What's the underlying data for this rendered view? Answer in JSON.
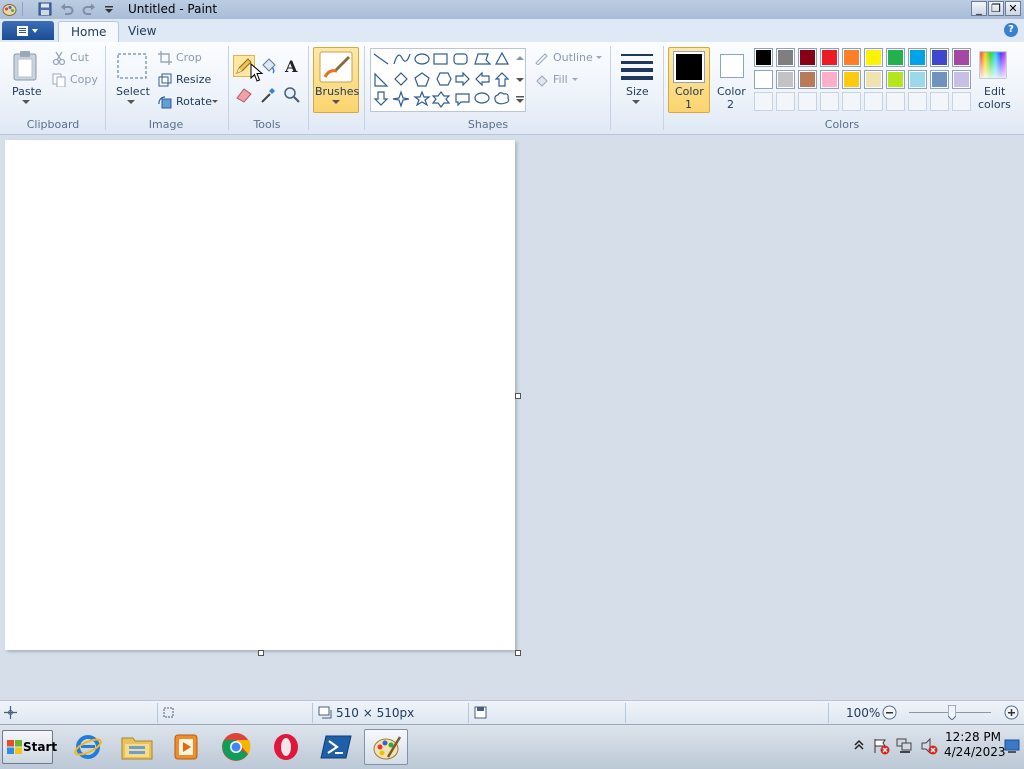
{
  "window": {
    "title": "Untitled - Paint",
    "controls": {
      "minimize": "_",
      "restore": "❐",
      "close": "✕"
    }
  },
  "tabs": [
    {
      "label": "Home",
      "active": true
    },
    {
      "label": "View",
      "active": false
    }
  ],
  "help": "?",
  "ribbon": {
    "clipboard": {
      "paste": "Paste",
      "cut": "Cut",
      "copy": "Copy",
      "group": "Clipboard"
    },
    "image": {
      "select": "Select",
      "crop": "Crop",
      "resize": "Resize",
      "rotate": "Rotate",
      "group": "Image"
    },
    "tools": {
      "group": "Tools"
    },
    "brushes": {
      "label": "Brushes"
    },
    "shapes": {
      "outline": "Outline",
      "fill": "Fill",
      "group": "Shapes"
    },
    "size": {
      "label": "Size"
    },
    "color1": {
      "line1": "Color",
      "line2": "1",
      "value": "#000000"
    },
    "color2": {
      "line1": "Color",
      "line2": "2",
      "value": "#ffffff"
    },
    "colors": {
      "group": "Colors"
    },
    "edit_colors": {
      "line1": "Edit",
      "line2": "colors"
    },
    "palette": [
      [
        "#000000",
        "#7f7f7f",
        "#880015",
        "#ed1c24",
        "#ff7f27",
        "#fff200",
        "#22b14c",
        "#00a2e8",
        "#3f48cc",
        "#a349a4"
      ],
      [
        "#ffffff",
        "#c3c3c3",
        "#b97a57",
        "#ffaec9",
        "#ffc90e",
        "#efe4b0",
        "#b5e61d",
        "#99d9ea",
        "#7092be",
        "#c8bfe7"
      ],
      [
        "",
        "",
        "",
        "",
        "",
        "",
        "",
        "",
        "",
        ""
      ]
    ]
  },
  "statusbar": {
    "dimensions": "510 × 510px",
    "zoom": "100%",
    "zoom_level_percent": 100
  },
  "taskbar": {
    "start": "Start",
    "clock_time": "12:28 PM",
    "clock_date": "4/24/2023"
  }
}
